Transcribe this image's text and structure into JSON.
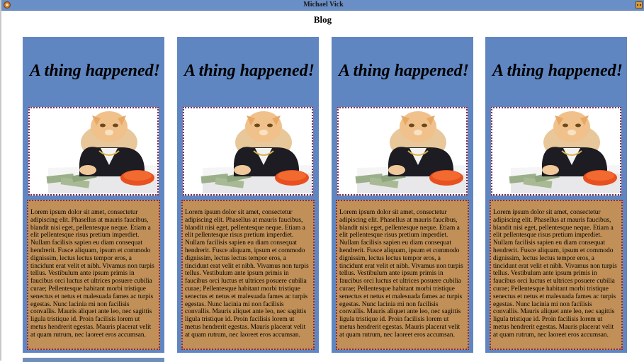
{
  "window": {
    "title": "Michael Vick",
    "app_icon": "app-orb-icon",
    "menu_icon": "window-menu-icon"
  },
  "page": {
    "heading": "Blog"
  },
  "posts": [
    {
      "title": "A thing happened!",
      "image": "cat-in-suit-with-money-image",
      "body": "Lorem ipsum dolor sit amet, consectetur adipiscing elit. Phasellus at mauris faucibus, blandit nisi eget, pellentesque neque. Etiam a elit pellentesque risus pretium imperdiet. Nullam facilisis sapien eu diam consequat hendrerit. Fusce aliquam, ipsum et commodo dignissim, lectus lectus tempor eros, a tincidunt erat velit et nibh. Vivamus non turpis tellus. Vestibulum ante ipsum primis in faucibus orci luctus et ultrices posuere cubilia curae; Pellentesque habitant morbi tristique senectus et netus et malesuada fames ac turpis egestas. Nunc lacinia mi non facilisis convallis. Mauris aliquet ante leo, nec sagittis ligula tristique id. Proin facilisis lorem ut metus hendrerit egestas. Mauris placerat velit at quam rutrum, nec laoreet eros accumsan."
    },
    {
      "title": "A thing happened!",
      "image": "cat-in-suit-with-money-image",
      "body": "Lorem ipsum dolor sit amet, consectetur adipiscing elit. Phasellus at mauris faucibus, blandit nisi eget, pellentesque neque. Etiam a elit pellentesque risus pretium imperdiet. Nullam facilisis sapien eu diam consequat hendrerit. Fusce aliquam, ipsum et commodo dignissim, lectus lectus tempor eros, a tincidunt erat velit et nibh. Vivamus non turpis tellus. Vestibulum ante ipsum primis in faucibus orci luctus et ultrices posuere cubilia curae; Pellentesque habitant morbi tristique senectus et netus et malesuada fames ac turpis egestas. Nunc lacinia mi non facilisis convallis. Mauris aliquet ante leo, nec sagittis ligula tristique id. Proin facilisis lorem ut metus hendrerit egestas. Mauris placerat velit at quam rutrum, nec laoreet eros accumsan."
    },
    {
      "title": "A thing happened!",
      "image": "cat-in-suit-with-money-image",
      "body": "Lorem ipsum dolor sit amet, consectetur adipiscing elit. Phasellus at mauris faucibus, blandit nisi eget, pellentesque neque. Etiam a elit pellentesque risus pretium imperdiet. Nullam facilisis sapien eu diam consequat hendrerit. Fusce aliquam, ipsum et commodo dignissim, lectus lectus tempor eros, a tincidunt erat velit et nibh. Vivamus non turpis tellus. Vestibulum ante ipsum primis in faucibus orci luctus et ultrices posuere cubilia curae; Pellentesque habitant morbi tristique senectus et netus et malesuada fames ac turpis egestas. Nunc lacinia mi non facilisis convallis. Mauris aliquet ante leo, nec sagittis ligula tristique id. Proin facilisis lorem ut metus hendrerit egestas. Mauris placerat velit at quam rutrum, nec laoreet eros accumsan."
    },
    {
      "title": "A thing happened!",
      "image": "cat-in-suit-with-money-image",
      "body": "Lorem ipsum dolor sit amet, consectetur adipiscing elit. Phasellus at mauris faucibus, blandit nisi eget, pellentesque neque. Etiam a elit pellentesque risus pretium imperdiet. Nullam facilisis sapien eu diam consequat hendrerit. Fusce aliquam, ipsum et commodo dignissim, lectus lectus tempor eros, a tincidunt erat velit et nibh. Vivamus non turpis tellus. Vestibulum ante ipsum primis in faucibus orci luctus et ultrices posuere cubilia curae; Pellentesque habitant morbi tristique senectus et netus et malesuada fames ac turpis egestas. Nunc lacinia mi non facilisis convallis. Mauris aliquet ante leo, nec sagittis ligula tristique id. Proin facilisis lorem ut metus hendrerit egestas. Mauris placerat velit at quam rutrum, nec laoreet eros accumsan."
    }
  ],
  "colors": {
    "titlebar": "#6a8fc6",
    "card": "#5f86c1",
    "text_box": "#c09058",
    "dotted_border": "#8a2a4a"
  }
}
